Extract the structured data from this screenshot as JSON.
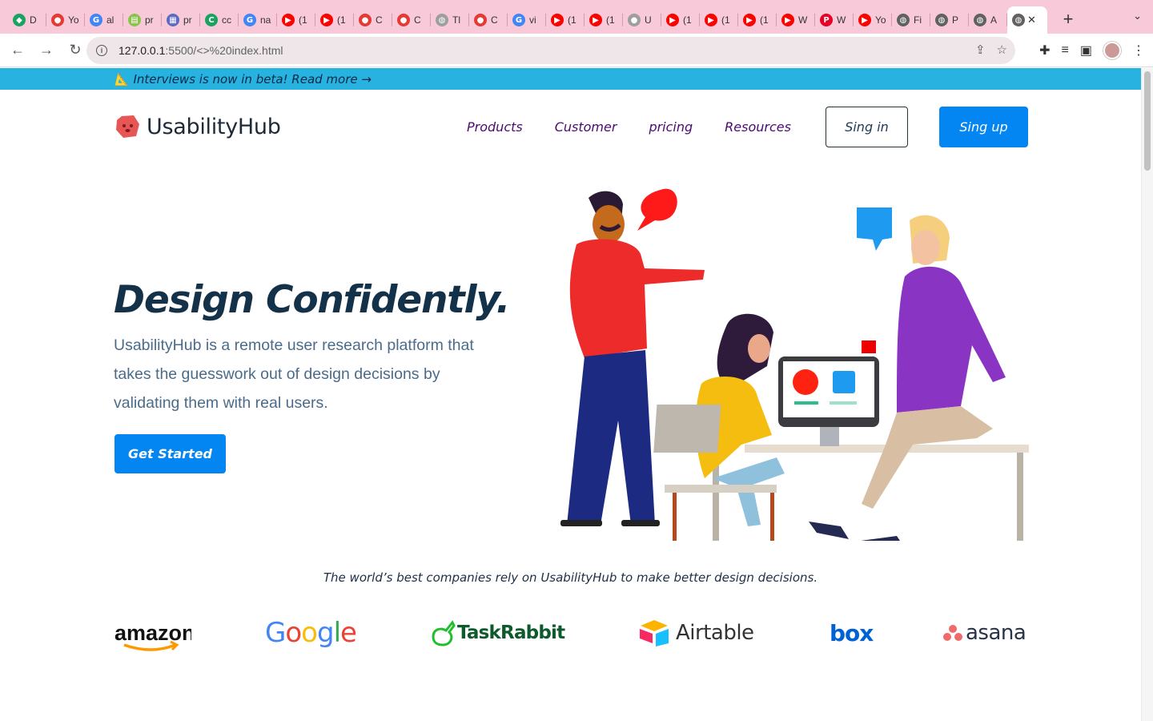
{
  "browser": {
    "tabs": [
      {
        "title": "D",
        "icon": "cube-icon",
        "color": "#1aa260"
      },
      {
        "title": "Yo",
        "icon": "hub-icon",
        "color": "#e53935"
      },
      {
        "title": "al",
        "icon": "google-icon",
        "color": "#4285f4"
      },
      {
        "title": "pr",
        "icon": "page-icon",
        "color": "#8bc34a"
      },
      {
        "title": "pr",
        "icon": "store-icon",
        "color": "#5c6bc0"
      },
      {
        "title": "cc",
        "icon": "cdf-icon",
        "color": "#1aa35f"
      },
      {
        "title": "na",
        "icon": "google-icon",
        "color": "#4285f4"
      },
      {
        "title": "(1",
        "icon": "youtube-icon",
        "color": "#ff0000"
      },
      {
        "title": "(1",
        "icon": "youtube-icon",
        "color": "#ff0000"
      },
      {
        "title": "C",
        "icon": "hub-icon",
        "color": "#e53935"
      },
      {
        "title": "C",
        "icon": "hub-icon",
        "color": "#e53935"
      },
      {
        "title": "Tl",
        "icon": "globe-icon",
        "color": "#9e9e9e"
      },
      {
        "title": "C",
        "icon": "hub-icon",
        "color": "#e53935"
      },
      {
        "title": "vi",
        "icon": "google-icon",
        "color": "#4285f4"
      },
      {
        "title": "(1",
        "icon": "youtube-icon",
        "color": "#ff0000"
      },
      {
        "title": "(1",
        "icon": "youtube-icon",
        "color": "#ff0000"
      },
      {
        "title": "U",
        "icon": "github-icon",
        "color": "#9e9e9e"
      },
      {
        "title": "(1",
        "icon": "youtube-icon",
        "color": "#ff0000"
      },
      {
        "title": "(1",
        "icon": "youtube-icon",
        "color": "#ff0000"
      },
      {
        "title": "(1",
        "icon": "youtube-icon",
        "color": "#ff0000"
      },
      {
        "title": "W",
        "icon": "youtube-icon",
        "color": "#ff0000"
      },
      {
        "title": "W",
        "icon": "pinterest-icon",
        "color": "#e60023"
      },
      {
        "title": "Yo",
        "icon": "youtube-icon",
        "color": "#ff0000"
      },
      {
        "title": "Fi",
        "icon": "globe-icon",
        "color": "#616161"
      },
      {
        "title": "P",
        "icon": "globe-icon",
        "color": "#616161"
      },
      {
        "title": "A",
        "icon": "globe-icon",
        "color": "#616161"
      }
    ],
    "active_tab": {
      "icon": "globe-icon",
      "close": "✕"
    },
    "new_tab": "+",
    "url_host": "127.0.0.1",
    "url_rest": ":5500/<>%20index.html"
  },
  "banner": {
    "text": "📐 Interviews is now in beta! Read more →"
  },
  "nav": {
    "logo": "UsabilityHub",
    "menu": [
      "Products",
      "Customer",
      "pricing",
      "Resources"
    ],
    "signin": "Sing in",
    "signup": "Sing up"
  },
  "hero": {
    "title": "Design Confidently.",
    "desc": "UsabilityHub is a remote user research platform that takes the guesswork out of design decisions by validating them with real users.",
    "cta": "Get Started"
  },
  "trust": {
    "text": "The world’s best companies rely on UsabilityHub to make better design decisions.",
    "brands": [
      "amazon",
      "Google",
      "TaskRabbit",
      "Airtable",
      "box",
      "asana"
    ]
  },
  "colors": {
    "primary": "#0385f2",
    "banner": "#27b2df",
    "menu": "#4b0a73",
    "heading": "#13324a"
  }
}
